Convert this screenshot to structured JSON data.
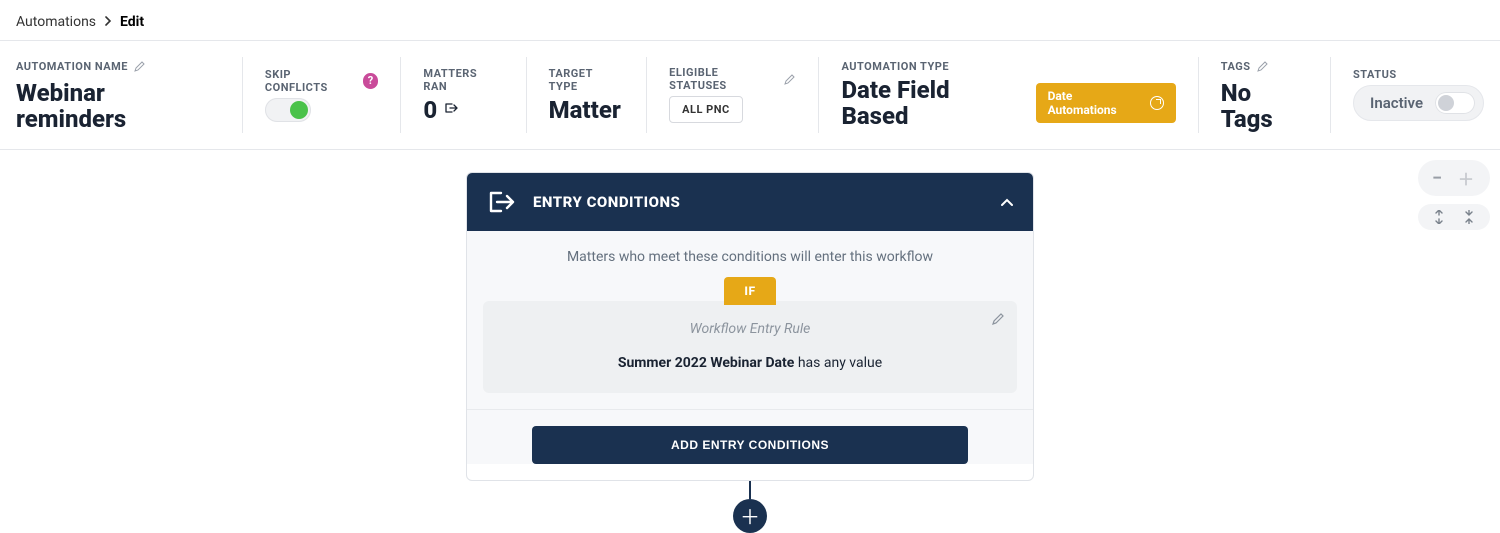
{
  "breadcrumb": {
    "root": "Automations",
    "current": "Edit"
  },
  "summary": {
    "name_label": "AUTOMATION NAME",
    "name_value": "Webinar reminders",
    "skip_conflicts_label": "SKIP CONFLICTS",
    "skip_conflicts_on": true,
    "matters_ran_label": "MATTERS RAN",
    "matters_ran_value": "0",
    "target_type_label": "TARGET TYPE",
    "target_type_value": "Matter",
    "eligible_statuses_label": "ELIGIBLE STATUSES",
    "eligible_statuses_chip": "ALL PNC",
    "automation_type_label": "AUTOMATION TYPE",
    "automation_type_value": "Date Field Based",
    "automation_type_chip": "Date Automations",
    "tags_label": "TAGS",
    "tags_value": "No Tags",
    "status_label": "STATUS",
    "status_value": "Inactive",
    "status_active": false
  },
  "entry_card": {
    "header": "ENTRY CONDITIONS",
    "description": "Matters who meet these conditions will enter this workflow",
    "if_label": "IF",
    "rule_subtitle": "Workflow Entry Rule",
    "rule_field": "Summer 2022 Webinar Date",
    "rule_condition": " has any value",
    "add_button": "ADD ENTRY CONDITIONS"
  },
  "icons": {
    "help": "?",
    "breadcrumb_sep": "›",
    "plus": "＋",
    "minus": "−"
  }
}
